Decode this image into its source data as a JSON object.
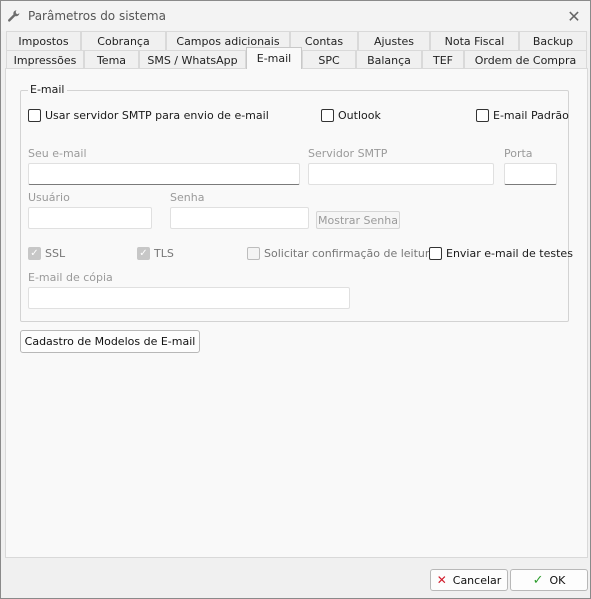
{
  "window": {
    "title": "Parâmetros do sistema"
  },
  "icons": {
    "app": "wrench-icon",
    "close": "close-icon",
    "cancel": "x-icon",
    "ok": "check-icon"
  },
  "colors": {
    "cancel_icon": "#d11a2a",
    "ok_icon": "#2e9e2e"
  },
  "tabs_row1": [
    "Impostos",
    "Cobrança",
    "Campos adicionais",
    "Contas",
    "Ajustes",
    "Nota Fiscal",
    "Backup"
  ],
  "tabs_row2": [
    "Impressões",
    "Tema",
    "SMS / WhatsApp",
    "E-mail",
    "SPC",
    "Balança",
    "TEF",
    "Ordem de Compra"
  ],
  "active_tab": "E-mail",
  "email": {
    "group_title": "E-mail",
    "use_smtp_label": "Usar servidor SMTP para envio de e-mail",
    "use_smtp_checked": false,
    "outlook_label": "Outlook",
    "outlook_checked": false,
    "default_email_label": "E-mail Padrão",
    "default_email_checked": false,
    "your_email_label": "Seu e-mail",
    "your_email_value": "",
    "smtp_server_label": "Servidor SMTP",
    "smtp_server_value": "",
    "port_label": "Porta",
    "port_value": "",
    "user_label": "Usuário",
    "user_value": "",
    "password_label": "Senha",
    "password_value": "",
    "show_password_label": "Mostrar Senha",
    "ssl_label": "SSL",
    "ssl_checked": true,
    "tls_label": "TLS",
    "tls_checked": true,
    "read_receipt_label": "Solicitar confirmação de leitura",
    "read_receipt_checked": false,
    "send_test_label": "Enviar e-mail de testes",
    "send_test_checked": false,
    "cc_email_label": "E-mail de cópia",
    "cc_email_value": ""
  },
  "templates_button": "Cadastro de Modelos de E-mail",
  "footer": {
    "cancel_label": "Cancelar",
    "ok_label": "OK"
  }
}
